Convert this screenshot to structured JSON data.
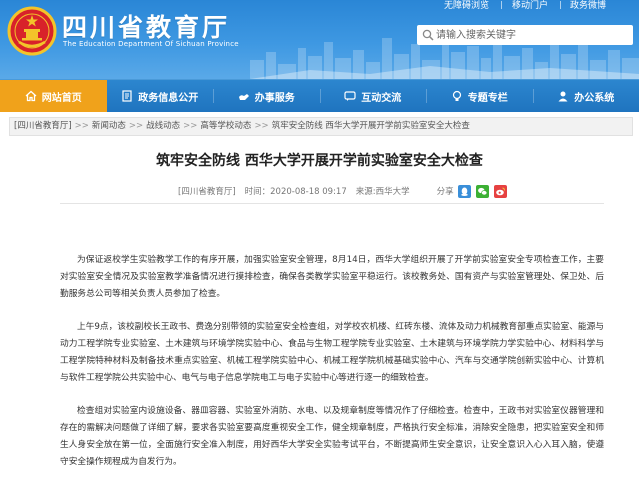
{
  "header": {
    "title": "四川省教育厅",
    "subtitle": "The Education Department Of Sichuan Province",
    "top_links": [
      "无障碍浏览",
      "移动门户",
      "政务微博"
    ],
    "search_placeholder": "请输入搜索关键字",
    "accent_color": "#2a86d6"
  },
  "nav": {
    "items": [
      {
        "label": "网站首页",
        "icon": "home-icon",
        "active": true
      },
      {
        "label": "政务信息公开",
        "icon": "document-icon",
        "active": false
      },
      {
        "label": "办事服务",
        "icon": "service-icon",
        "active": false
      },
      {
        "label": "互动交流",
        "icon": "chat-icon",
        "active": false
      },
      {
        "label": "专题专栏",
        "icon": "lightbulb-icon",
        "active": false
      },
      {
        "label": "办公系统",
        "icon": "user-icon",
        "active": false
      }
    ],
    "active_color": "#f0a21b"
  },
  "breadcrumb": [
    "[四川省教育厅]",
    "新闻动态",
    "战线动态",
    "高等学校动态",
    "筑牢安全防线 西华大学开展开学前实验室安全大检查"
  ],
  "article": {
    "title": "筑牢安全防线 西华大学开展开学前实验室安全大检查",
    "meta_source_site": "[四川省教育厅]",
    "meta_time": "时间：2020-08-18 09:17",
    "meta_source": "来源:西华大学",
    "share_label": "分享",
    "share_buttons": [
      "qq-icon",
      "wechat-icon",
      "weibo-icon"
    ],
    "paragraphs": [
      "为保证返校学生实验教学工作的有序开展，加强实验室安全管理，8月14日，西华大学组织开展了开学前实验室安全专项检查工作，主要对实验室安全情况及实验室教学准备情况进行摸排检查，确保各类教学实验室平稳运行。该校教务处、国有资产与实验室管理处、保卫处、后勤服务总公司等相关负责人员参加了检查。",
      "上午9点，该校副校长王政书、费逸分别带领的实验室安全检查组，对学校农机楼、红砖东楼、流体及动力机械教育部重点实验室、能源与动力工程学院专业实验室、土木建筑与环境学院实验中心、食品与生物工程学院专业实验室、土木建筑与环境学院力学实验中心、材料科学与工程学院特种材料及制备技术重点实验室、机械工程学院实验中心、机械工程学院机械基础实验中心、汽车与交通学院创新实验中心、计算机与软件工程学院公共实验中心、电气与电子信息学院电工与电子实验中心等进行逐一的细致检查。",
      "检查组对实验室内设施设备、器皿容器、实验室外消防、水电、以及规章制度等情况作了仔细检查。检查中，王政书对实验室仪器管理和存在的需解决问题做了详细了解，要求各实验室要高度重视安全工作，健全规章制度，严格执行安全标准，消除安全隐患，把实验室安全和师生人身安全放在第一位，全面施行安全准入制度，用好西华大学安全实验考试平台，不断提高师生安全意识，让安全意识入心入耳入脑，使遵守安全操作规程成为自发行为。"
    ]
  }
}
